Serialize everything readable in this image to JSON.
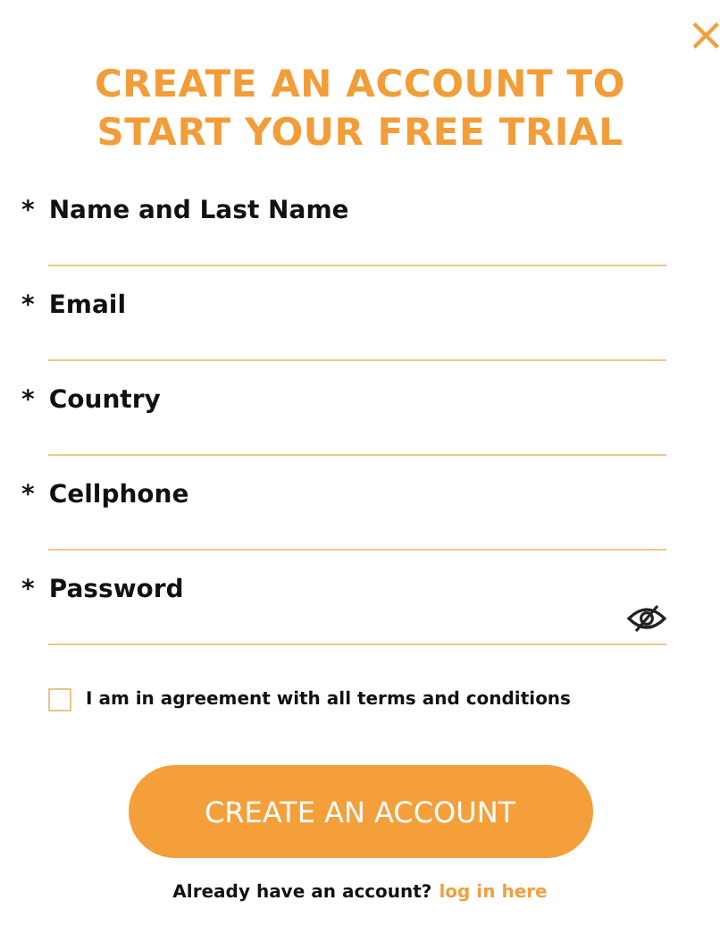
{
  "close": {
    "glyph": "×"
  },
  "title": "CREATE AN ACCOUNT TO START YOUR FREE TRIAL",
  "fields": [
    {
      "label": "Name and Last Name",
      "required_mark": "*",
      "kind": "text"
    },
    {
      "label": "Email",
      "required_mark": "*",
      "kind": "text"
    },
    {
      "label": "Country",
      "required_mark": "*",
      "kind": "text"
    },
    {
      "label": "Cellphone",
      "required_mark": "*",
      "kind": "text"
    },
    {
      "label": "Password",
      "required_mark": "*",
      "kind": "password"
    }
  ],
  "agreement": {
    "label": "I am in agreement with all terms and conditions",
    "checked": false
  },
  "submit_button": "CREATE AN ACCOUNT",
  "footer": {
    "text": "Already have an account?",
    "link": "log in here"
  }
}
